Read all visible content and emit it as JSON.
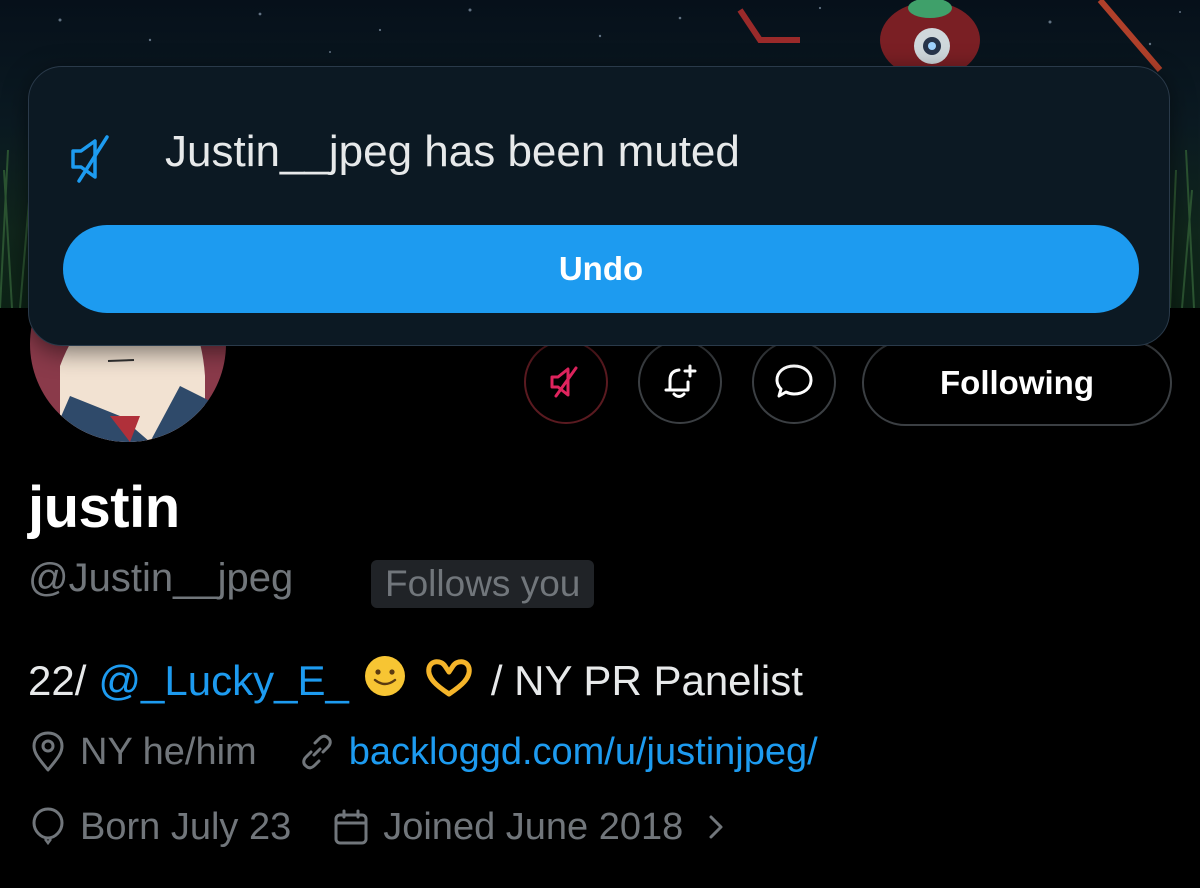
{
  "toast": {
    "message": "Justin__jpeg has been muted",
    "undo_label": "Undo",
    "icon": "muted-speaker-icon"
  },
  "actions": {
    "mute_icon": "muted-speaker-icon",
    "notify_icon": "bell-plus-icon",
    "message_icon": "chat-bubble-icon",
    "following_label": "Following"
  },
  "profile": {
    "display_name": "justin",
    "handle": "@Justin__jpeg",
    "follows_you": "Follows you",
    "bio": {
      "prefix": "22/",
      "mention": "@_Lucky_E_",
      "emojis": [
        "smiling-face-emoji",
        "heart-hands-emoji"
      ],
      "suffix": "/ NY PR Panelist"
    },
    "location": "NY he/him",
    "website": "backloggd.com/u/justinjpeg/",
    "birthday": "Born July 23",
    "joined": "Joined June 2018"
  },
  "colors": {
    "accent": "#1d9bf0",
    "muted_red": "#e0245e",
    "secondary_text": "#71767b",
    "toast_bg": "#0c1923"
  }
}
